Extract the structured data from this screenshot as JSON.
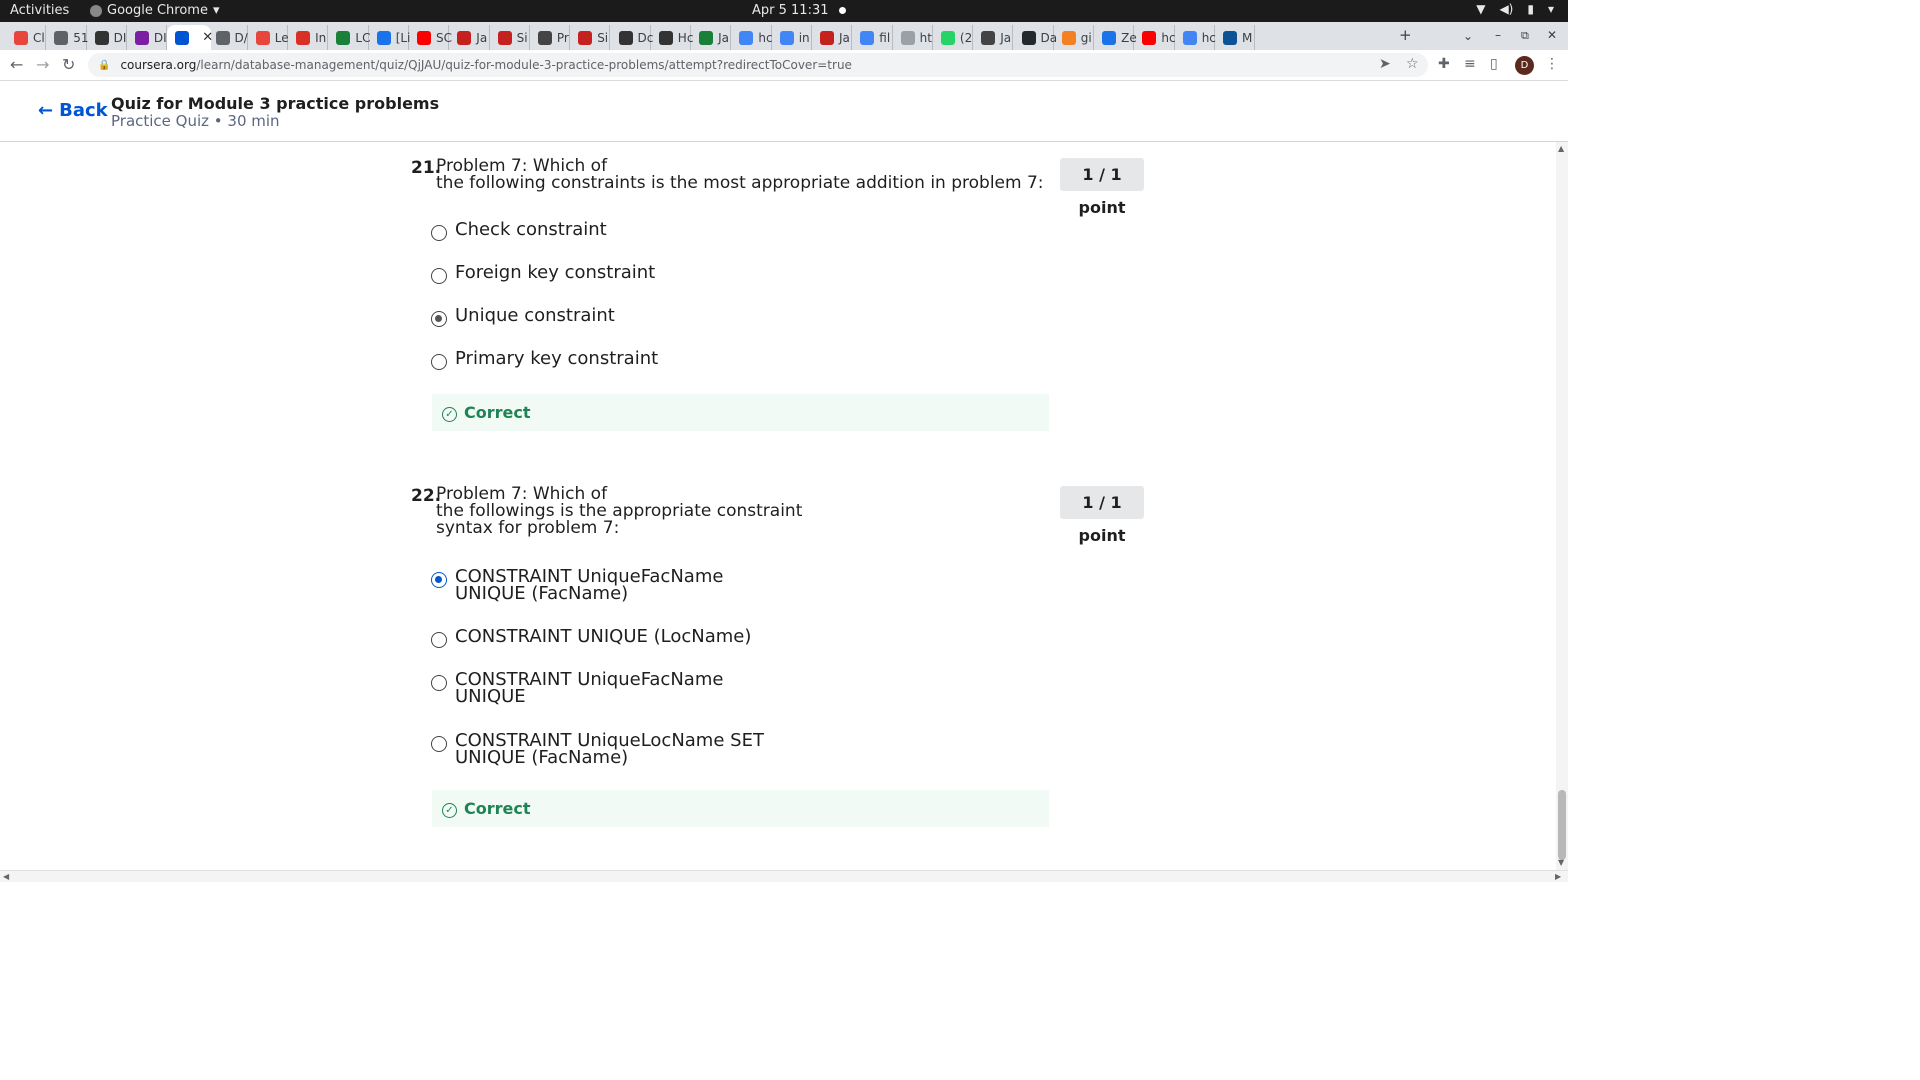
{
  "system_bar": {
    "activities": "Activities",
    "app_name": "Google Chrome",
    "datetime": "Apr 5  11:31"
  },
  "browser": {
    "tabs": [
      {
        "label": "Cl",
        "color": "#e8453c"
      },
      {
        "label": "51",
        "color": "#5f6368"
      },
      {
        "label": "DI",
        "color": "#333333"
      },
      {
        "label": "DI",
        "color": "#7b1fa2"
      },
      {
        "label": "",
        "color": "#0056d2",
        "active": true
      },
      {
        "label": "D/",
        "color": "#5f6368"
      },
      {
        "label": "Le",
        "color": "#e8453c"
      },
      {
        "label": "In",
        "color": "#d93025"
      },
      {
        "label": "LC",
        "color": "#188038"
      },
      {
        "label": "[Li",
        "color": "#1a73e8"
      },
      {
        "label": "SC",
        "color": "#ff0000"
      },
      {
        "label": "Ja",
        "color": "#c5221f"
      },
      {
        "label": "Si",
        "color": "#c5221f"
      },
      {
        "label": "Pr",
        "color": "#444444"
      },
      {
        "label": "Si",
        "color": "#c5221f"
      },
      {
        "label": "Dc",
        "color": "#333333"
      },
      {
        "label": "Hc",
        "color": "#333333"
      },
      {
        "label": "Ja",
        "color": "#188038"
      },
      {
        "label": "hc",
        "color": "#4285f4"
      },
      {
        "label": "in",
        "color": "#4285f4"
      },
      {
        "label": "Ja",
        "color": "#c5221f"
      },
      {
        "label": "fil",
        "color": "#4285f4"
      },
      {
        "label": "ht",
        "color": "#9aa0a6"
      },
      {
        "label": "(2",
        "color": "#25d366"
      },
      {
        "label": "Ja",
        "color": "#444444"
      },
      {
        "label": "Da",
        "color": "#24292e"
      },
      {
        "label": "gi",
        "color": "#f48024"
      },
      {
        "label": "Ze",
        "color": "#1a73e8"
      },
      {
        "label": "hc",
        "color": "#ff0000"
      },
      {
        "label": "hc",
        "color": "#4285f4"
      },
      {
        "label": "M",
        "color": "#0b5394"
      }
    ],
    "new_tab": "+",
    "url_host": "coursera.org",
    "url_path": "/learn/database-management/quiz/QjJAU/quiz-for-module-3-practice-problems/attempt?redirectToCover=true",
    "profile_initial": "D"
  },
  "header": {
    "back_label": "Back",
    "title": "Quiz for Module 3 practice problems",
    "subtitle": "Practice Quiz • 30 min"
  },
  "questions": [
    {
      "number": "21.",
      "text": "Problem 7: Which of\nthe following constraints is the most appropriate addition in problem 7:",
      "points": "1 / 1 point",
      "options": [
        {
          "label": "Check constraint",
          "selected": false
        },
        {
          "label": "Foreign key constraint",
          "selected": false
        },
        {
          "label": "Unique constraint",
          "selected": true
        },
        {
          "label": "Primary key constraint",
          "selected": false
        }
      ],
      "feedback": "Correct"
    },
    {
      "number": "22.",
      "text": "Problem 7: Which of\nthe followings is the appropriate constraint\nsyntax for problem 7:",
      "points": "1 / 1 point",
      "options": [
        {
          "label": "CONSTRAINT UniqueFacName\nUNIQUE (FacName)",
          "selected": true
        },
        {
          "label": "CONSTRAINT UNIQUE (LocName)",
          "selected": false
        },
        {
          "label": "CONSTRAINT UniqueFacName\nUNIQUE",
          "selected": false
        },
        {
          "label": "CONSTRAINT UniqueLocName SET\nUNIQUE (FacName)",
          "selected": false
        }
      ],
      "feedback": "Correct"
    }
  ]
}
